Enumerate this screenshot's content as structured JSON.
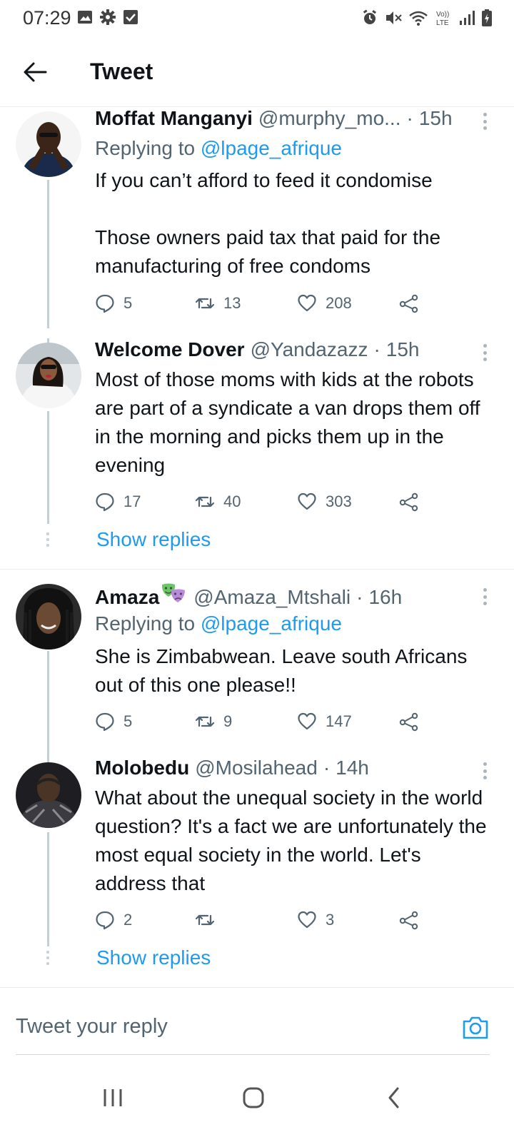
{
  "status_bar": {
    "time": "07:29",
    "left_icons": [
      "image-icon",
      "gear-icon",
      "checkbox-icon"
    ],
    "right_icons": [
      "alarm-icon",
      "mute-icon",
      "wifi-icon",
      "volte-icon",
      "signal-icon",
      "battery-icon"
    ],
    "volte_text": "Vo))\nLTE"
  },
  "header": {
    "title": "Tweet",
    "back_icon": "arrow-left-icon"
  },
  "tweets": [
    {
      "name": "Moffat Manganyi",
      "handle": "@murphy_mo...",
      "separator": "·",
      "time": "15h",
      "replying_prefix": "Replying to",
      "replying_to": "@lpage_afrique",
      "text": "If you can’t afford to feed it condomise\n\nThose owners paid tax that paid for the manufacturing of free condoms",
      "replies": "5",
      "retweets": "13",
      "likes": "208"
    },
    {
      "name": "Welcome Dover",
      "handle": "@Yandazazz",
      "separator": "·",
      "time": "15h",
      "text": "Most of those moms with kids at the robots are part of a syndicate a van drops them off in the morning and picks them up in the evening",
      "replies": "17",
      "retweets": "40",
      "likes": "303",
      "show_replies": "Show replies"
    },
    {
      "name": "Amaza",
      "name_emoji": "performing-arts-masks",
      "handle": "@Amaza_Mtshali",
      "separator": "·",
      "time": "16h",
      "replying_prefix": "Replying to",
      "replying_to": "@lpage_afrique",
      "text": "She is Zimbabwean. Leave south Africans out of this one please!!",
      "replies": "5",
      "retweets": "9",
      "likes": "147"
    },
    {
      "name": "Molobedu",
      "handle": "@Mosilahead",
      "separator": "·",
      "time": "14h",
      "text": "What about the unequal society in the world question? It's a fact we are unfortunately the most equal society in the world. Let's address that",
      "replies": "2",
      "retweets": "",
      "likes": "3",
      "show_replies": "Show replies"
    }
  ],
  "composer": {
    "placeholder": "Tweet your reply",
    "camera_icon": "camera-icon"
  },
  "navbar": {
    "icons": [
      "recent-apps-icon",
      "home-icon",
      "back-icon"
    ]
  },
  "colors": {
    "accent": "#1d9bf0",
    "secondary_text": "#536471",
    "thread_line": "#c4cfd6",
    "divider": "#e6ecf0"
  }
}
